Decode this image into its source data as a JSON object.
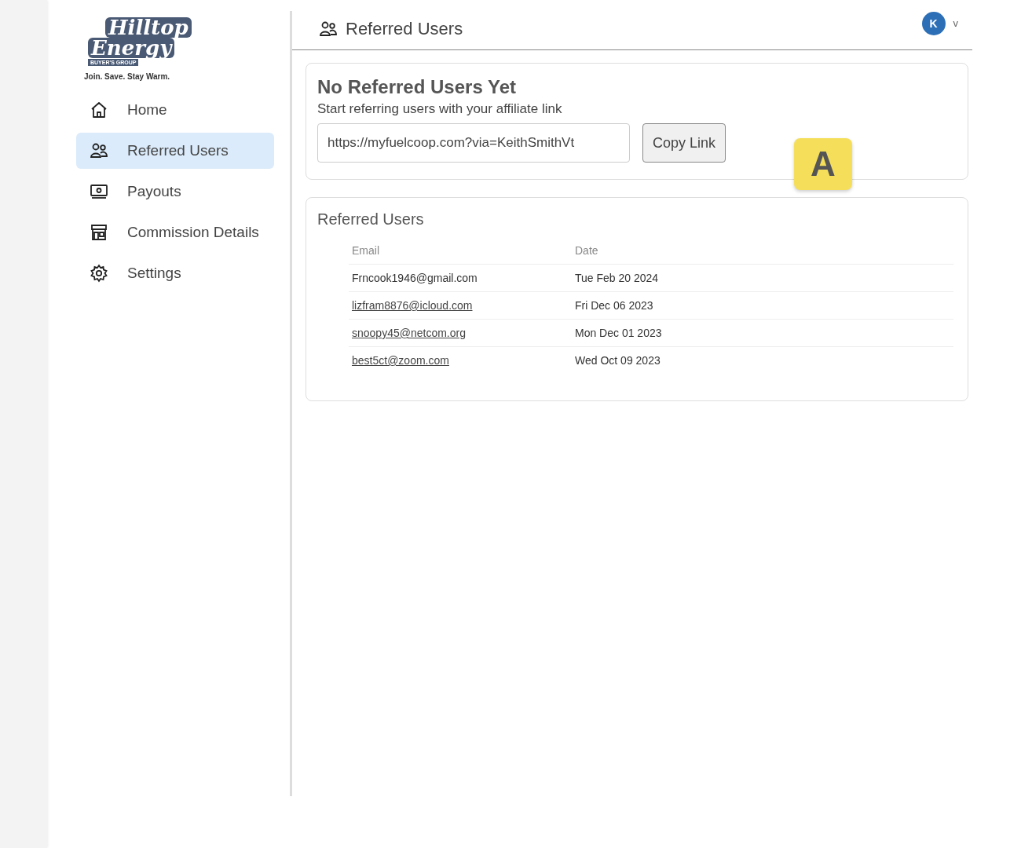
{
  "logo": {
    "line_1": "Hilltop",
    "line_2": "Energy",
    "subtitle": "BUYER'S GROUP",
    "tagline": "Join. Save. Stay Warm."
  },
  "sidebar": {
    "items": [
      {
        "label": "Home",
        "kind": "home",
        "selected": false
      },
      {
        "label": "Referred Users",
        "kind": "users",
        "selected": true
      },
      {
        "label": "Payouts",
        "kind": "money",
        "selected": false
      },
      {
        "label": "Commission Details",
        "kind": "store",
        "selected": false
      },
      {
        "label": "Settings",
        "kind": "gear",
        "selected": false
      }
    ]
  },
  "header": {
    "title": "Referred Users",
    "avatar": "K",
    "caret": "v"
  },
  "affiliate_card": {
    "title": "No Referred Users Yet",
    "subtitle": "Start referring users with your affiliate link",
    "link_value": "https://myfuelcoop.com?via=KeithSmithVt",
    "button": "Copy Link"
  },
  "callout": {
    "label": "A"
  },
  "referred_card": {
    "title": "Referred Users",
    "columns": [
      "Email",
      "Date"
    ],
    "rows": [
      {
        "email": "Frncook1946@gmail.com",
        "date": "Tue Feb 20 2024",
        "linked": false
      },
      {
        "email": "lizfram8876@icloud.com",
        "date": "Fri Dec 06 2023",
        "linked": true
      },
      {
        "email": "snoopy45@netcom.org",
        "date": "Mon Dec 01 2023",
        "linked": true
      },
      {
        "email": "best5ct@zoom.com",
        "date": "Wed Oct 09 2023",
        "linked": true
      }
    ]
  }
}
